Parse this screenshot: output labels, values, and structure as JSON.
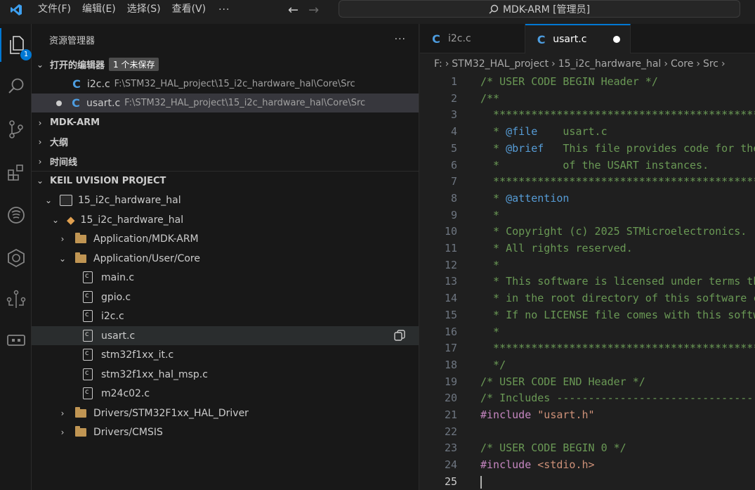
{
  "menu": {
    "items": [
      "文件(F)",
      "编辑(E)",
      "选择(S)",
      "查看(V)"
    ],
    "more": "···"
  },
  "command_center": {
    "label": "MDK-ARM [管理员]"
  },
  "activity": {
    "explorer_badge": "1"
  },
  "sidebar": {
    "title": "资源管理器",
    "more": "···",
    "open_editors": {
      "title": "打开的编辑器",
      "badge": "1 个未保存",
      "items": [
        {
          "name": "i2c.c",
          "path": "F:\\STM32_HAL_project\\15_i2c_hardware_hal\\Core\\Src"
        },
        {
          "name": "usart.c",
          "path": "F:\\STM32_HAL_project\\15_i2c_hardware_hal\\Core\\Src"
        }
      ]
    },
    "sections": [
      "MDK-ARM",
      "大纲",
      "时间线",
      "KEIL UVISION PROJECT"
    ],
    "tree": {
      "project": "15_i2c_hardware_hal",
      "target": "15_i2c_hardware_hal",
      "group1": "Application/MDK-ARM",
      "group2": "Application/User/Core",
      "files": [
        "main.c",
        "gpio.c",
        "i2c.c",
        "usart.c",
        "stm32f1xx_it.c",
        "stm32f1xx_hal_msp.c",
        "m24c02.c"
      ],
      "group3": "Drivers/STM32F1xx_HAL_Driver",
      "group4": "Drivers/CMSIS"
    }
  },
  "tabs": [
    {
      "label": "i2c.c"
    },
    {
      "label": "usart.c"
    }
  ],
  "breadcrumb": [
    "F:",
    "STM32_HAL_project",
    "15_i2c_hardware_hal",
    "Core",
    "Src"
  ],
  "editor": {
    "line_numbers": [
      "1",
      "2",
      "3",
      "4",
      "5",
      "6",
      "7",
      "8",
      "9",
      "10",
      "11",
      "12",
      "13",
      "14",
      "15",
      "16",
      "17",
      "18",
      "19",
      "20",
      "21",
      "22",
      "23",
      "24",
      "25"
    ],
    "lines": [
      "/* USER CODE BEGIN Header */",
      "/**",
      "  ******************************************************************************",
      "  * ",
      "  * ",
      "  *          of the USART instances.",
      "  ******************************************************************************",
      "  * ",
      "  *",
      "  * Copyright (c) 2025 STMicroelectronics.",
      "  * All rights reserved.",
      "  *",
      "  * This software is licensed under terms that can be found in the LICENSE file",
      "  * in the root directory of this software component.",
      "  * If no LICENSE file comes with this software, it is provided AS-IS.",
      "  *",
      "  ******************************************************************************",
      "  */",
      "/* USER CODE END Header */",
      "/* Includes ------------------------------------------------------------------*/",
      "",
      "",
      "/* USER CODE BEGIN 0 */",
      "",
      ""
    ],
    "doc_tags": {
      "file_tag": "@file",
      "file_value": "    usart.c",
      "brief_tag": "@brief",
      "brief_value": "   This file provides code for the configuration",
      "attention_tag": "@attention"
    },
    "include_kw": "#include",
    "include_usart": " \"usart.h\"",
    "include_stdio": " <stdio.h>"
  }
}
